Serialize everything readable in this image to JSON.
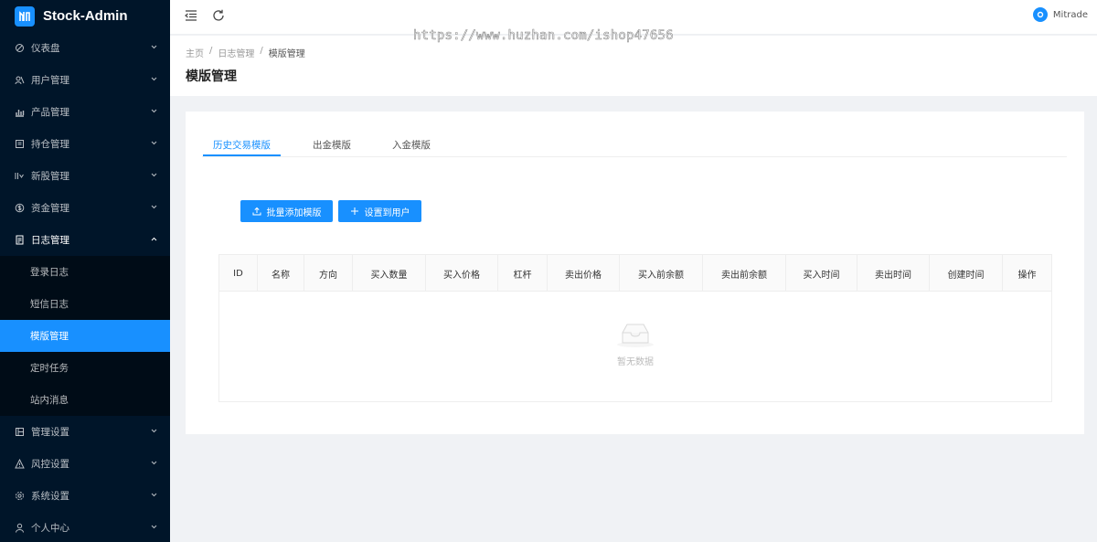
{
  "app": {
    "title": "Stock-Admin"
  },
  "sidebar": {
    "items": [
      {
        "label": "仪表盘",
        "icon": "dashboard-icon"
      },
      {
        "label": "用户管理",
        "icon": "users-icon"
      },
      {
        "label": "产品管理",
        "icon": "bar-chart-icon"
      },
      {
        "label": "持仓管理",
        "icon": "position-icon"
      },
      {
        "label": "新股管理",
        "icon": "ipo-icon"
      },
      {
        "label": "资金管理",
        "icon": "dollar-icon"
      },
      {
        "label": "日志管理",
        "icon": "log-icon",
        "children": [
          "登录日志",
          "短信日志",
          "模版管理",
          "定时任务",
          "站内消息"
        ],
        "active_child": "模版管理"
      },
      {
        "label": "管理设置",
        "icon": "settings-panel-icon"
      },
      {
        "label": "风控设置",
        "icon": "warning-icon"
      },
      {
        "label": "系统设置",
        "icon": "gear-icon"
      },
      {
        "label": "个人中心",
        "icon": "user-icon"
      }
    ]
  },
  "topbar": {
    "user_name": "Mitrade"
  },
  "watermark": "https://www.huzhan.com/ishop47656",
  "breadcrumb": [
    "主页",
    "日志管理",
    "模版管理"
  ],
  "breadcrumb_sep": "/",
  "page_title": "模版管理",
  "tabs": [
    "历史交易模版",
    "出金模版",
    "入金模版"
  ],
  "active_tab": "历史交易模版",
  "buttons": {
    "batch_add": "批量添加模版",
    "assign_user": "设置到用户"
  },
  "table": {
    "columns": [
      "ID",
      "名称",
      "方向",
      "买入数量",
      "买入价格",
      "杠杆",
      "卖出价格",
      "买入前余额",
      "卖出前余额",
      "买入时间",
      "卖出时间",
      "创建时间",
      "操作"
    ],
    "empty_text": "暂无数据"
  },
  "colors": {
    "primary": "#1890ff",
    "sidebar_bg": "#001529",
    "submenu_bg": "#000c17"
  }
}
